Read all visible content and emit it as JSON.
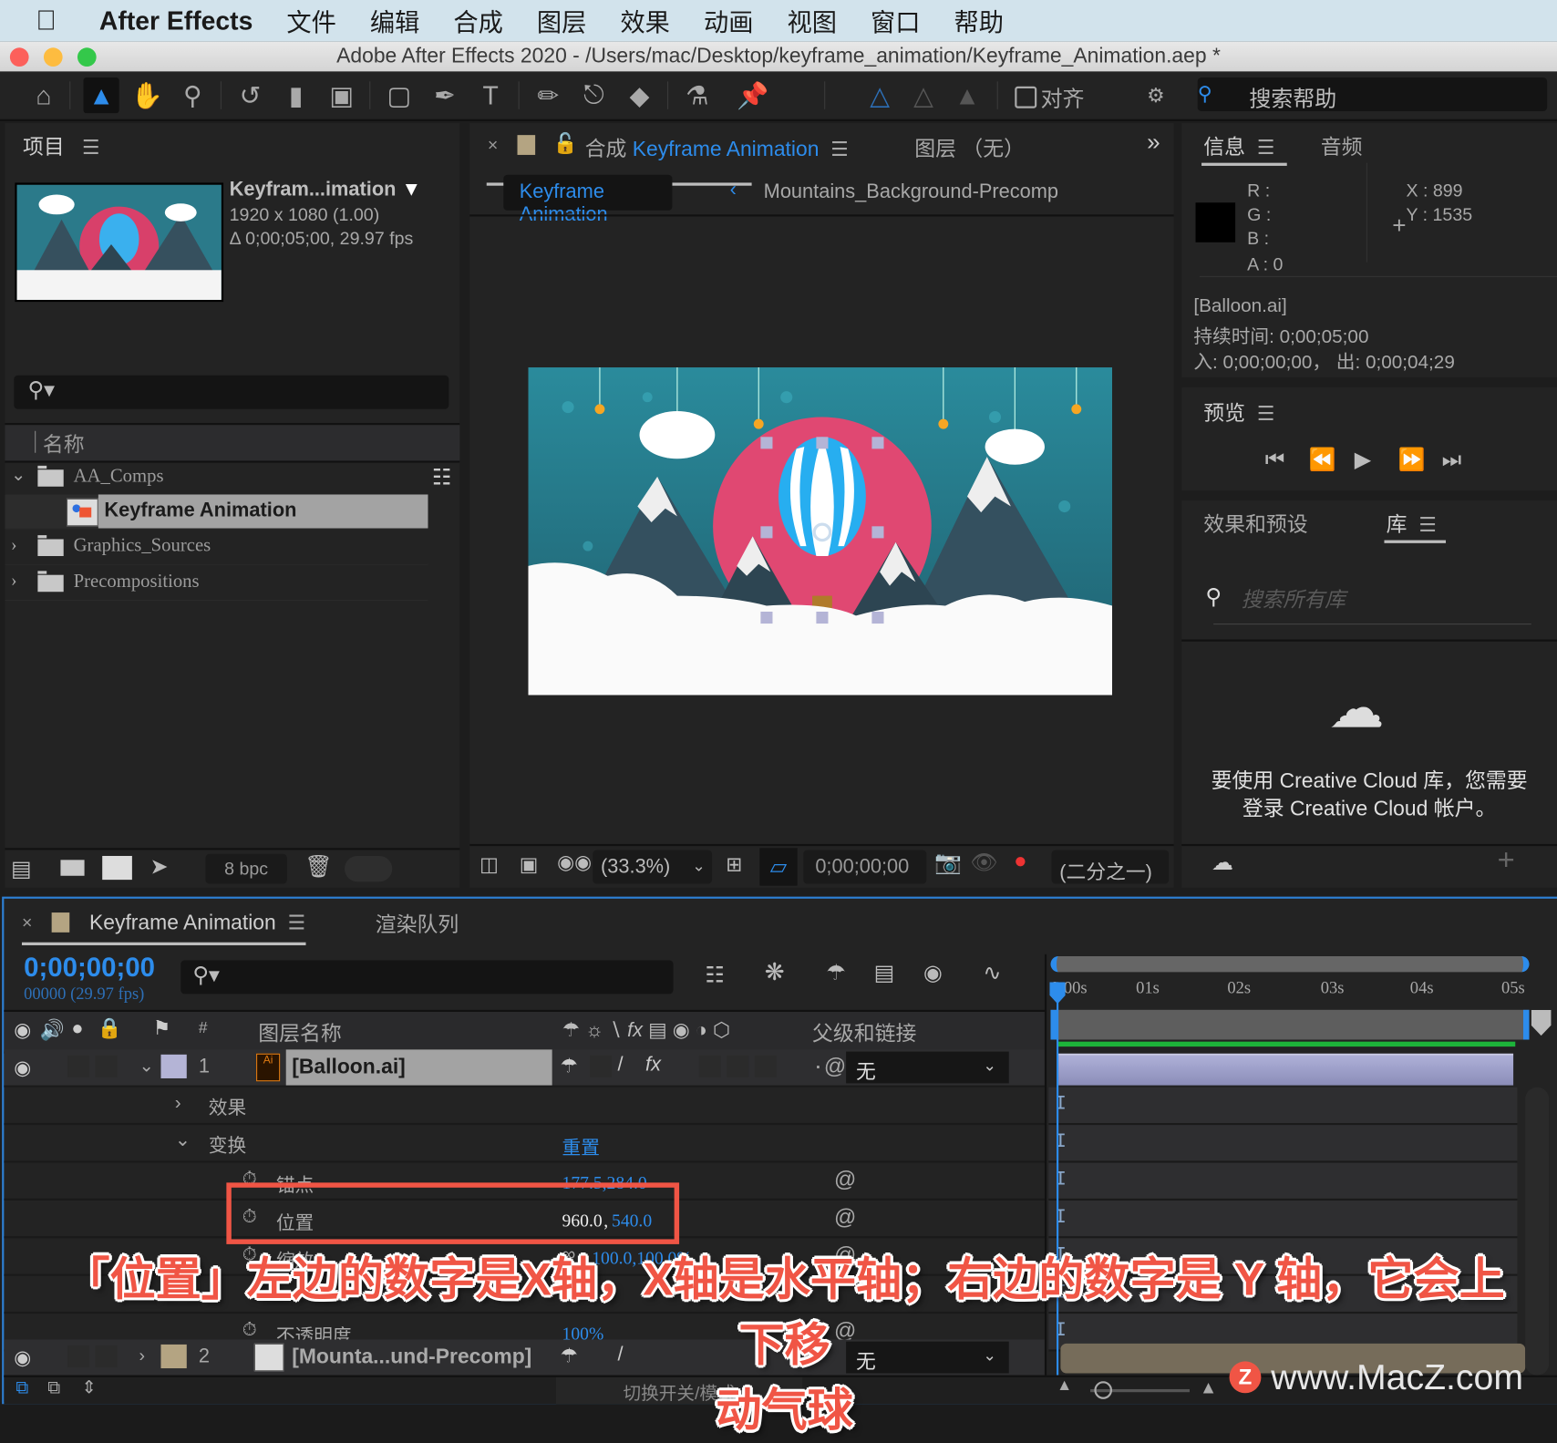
{
  "menubar": {
    "app_name": "After Effects",
    "items": [
      "文件",
      "编辑",
      "合成",
      "图层",
      "效果",
      "动画",
      "视图",
      "窗口",
      "帮助"
    ]
  },
  "window": {
    "title": "Adobe After Effects 2020 - /Users/mac/Desktop/keyframe_animation/Keyframe_Animation.aep *"
  },
  "toolbar": {
    "tools": [
      "home",
      "selection",
      "hand",
      "zoom",
      "rotate",
      "camera",
      "pan-behind",
      "rectangle",
      "pen",
      "type",
      "brush",
      "clone-stamp",
      "eraser",
      "roto-brush",
      "puppet-pin"
    ],
    "active_tool": "selection",
    "snap_label": "对齐",
    "help_search_placeholder": "搜索帮助"
  },
  "project": {
    "title": "项目",
    "selected_name": "Keyfram...imation",
    "resolution": "1920 x 1080 (1.00)",
    "duration": "Δ 0;00;05;00, 29.97 fps",
    "search_placeholder": "",
    "column_name": "名称",
    "items": [
      {
        "name": "AA_Comps",
        "type": "folder",
        "expanded": true
      },
      {
        "name": "Keyframe Animation",
        "type": "comp",
        "selected": true
      },
      {
        "name": "Graphics_Sources",
        "type": "folder",
        "expanded": false
      },
      {
        "name": "Precompositions",
        "type": "folder",
        "expanded": false
      }
    ],
    "bpc": "8 bpc"
  },
  "composition": {
    "tab_prefix": "合成",
    "tab_name": "Keyframe Animation",
    "layer_tab": "图层 （无）",
    "breadcrumb_active": "Keyframe Animation",
    "breadcrumb_next": "Mountains_Background-Precomp",
    "zoom": "(33.3%)",
    "timecode": "0;00;00;00",
    "resolution": "(二分之一)"
  },
  "info": {
    "tab": "信息",
    "tab2": "音频",
    "r": "R :",
    "g": "G :",
    "b": "B :",
    "a": "A :  0",
    "x": "X :  899",
    "y": "Y :  1535",
    "layer": "[Balloon.ai]",
    "duration": "持续时间: 0;00;05;00",
    "inout": "入: 0;00;00;00， 出: 0;00;04;29"
  },
  "preview": {
    "title": "预览"
  },
  "library": {
    "tab1": "效果和预设",
    "tab2": "库",
    "search_placeholder": "搜索所有库",
    "message_line1": "要使用 Creative Cloud 库，您需要",
    "message_line2": "登录 Creative Cloud 帐户。"
  },
  "timeline": {
    "tab": "Keyframe Animation",
    "tab2": "渲染队列",
    "timecode": "0;00;00;00",
    "frame_info": "00000 (29.97 fps)",
    "col_layer_name": "图层名称",
    "col_parent": "父级和链接",
    "col_num": "#",
    "ruler": [
      "0:00s",
      "01s",
      "02s",
      "03s",
      "04s",
      "05s"
    ],
    "layers": [
      {
        "num": "1",
        "name": "[Balloon.ai]",
        "parent": "无",
        "color": "#b4b4d6"
      },
      {
        "num": "2",
        "name": "[Mounta...und-Precomp]",
        "parent": "无",
        "color": "#b4a482"
      }
    ],
    "props": {
      "effects": "效果",
      "transform": "变换",
      "reset": "重置",
      "anchor_label": "锚点",
      "anchor_value": "177.5,284.0",
      "position_label": "位置",
      "position_x": "960.0",
      "position_y": "540.0",
      "scale_label": "缩放",
      "scale_value": "100.0,100.0%",
      "opacity_label": "不透明度",
      "opacity_value": "100%"
    },
    "toggle_label": "切换开关/模式"
  },
  "annotation": {
    "caption_line1": "「位置」左边的数字是X轴，X轴是水平轴；右边的数字是 Y 轴，它会上下移",
    "caption_line2": "动气球",
    "highlight_color": "#f05545"
  },
  "watermark": {
    "text": "www.MacZ.com",
    "badge": "Z"
  }
}
